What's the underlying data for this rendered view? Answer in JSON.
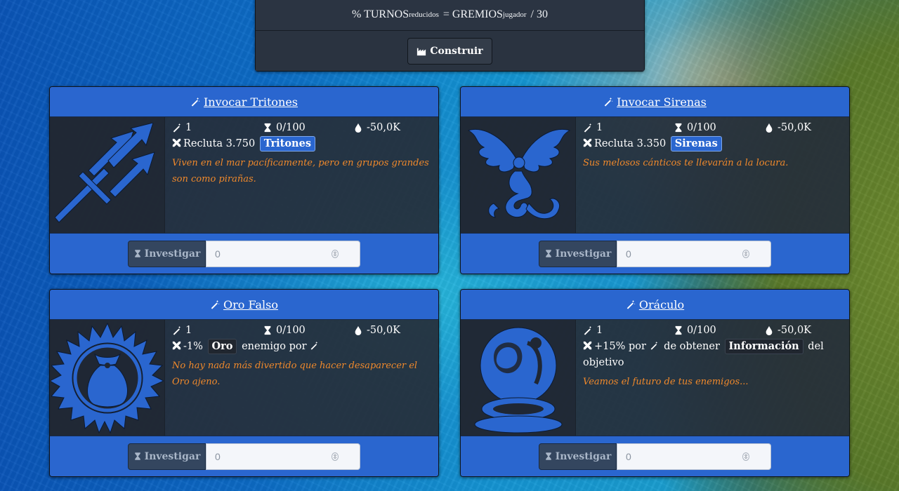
{
  "header": {
    "formula_prefix": "% TURNOS",
    "formula_sub1": "reducidos",
    "formula_mid": "= GREMIOS",
    "formula_sub2": "jugador",
    "formula_suffix": "/ 30",
    "build_label": "Construir"
  },
  "colors": {
    "accent": "#2a66cf",
    "panel": "#262e3a",
    "description": "#f0892b"
  },
  "cards": [
    {
      "title": "Invocar Tritones",
      "icon": "trident-icon",
      "level": "1",
      "progress": "0/100",
      "cost": "-50,0K",
      "line_pre": "Recluta 3.750",
      "badge": "Tritones",
      "description": "Viven en el mar pacíficamente, pero en grupos grandes son como pirañas.",
      "invest_label": "Investigar",
      "invest_value": "0"
    },
    {
      "title": "Invocar Sirenas",
      "icon": "siren-icon",
      "level": "1",
      "progress": "0/100",
      "cost": "-50,0K",
      "line_pre": "Recluta 3.350",
      "badge": "Sirenas",
      "description": "Sus melosos cánticos te llevarán a la locura.",
      "invest_label": "Investigar",
      "invest_value": "0"
    },
    {
      "title": "Oro Falso",
      "icon": "gold-sack-icon",
      "level": "1",
      "progress": "0/100",
      "cost": "-50,0K",
      "line_pre": "-1%",
      "badge": "Oro",
      "line_post": "enemigo por",
      "description": "No hay nada más divertido que hacer desaparecer el Oro ajeno.",
      "invest_label": "Investigar",
      "invest_value": "0"
    },
    {
      "title": "Oráculo",
      "icon": "crystal-ball-icon",
      "level": "1",
      "progress": "0/100",
      "cost": "-50,0K",
      "line_pre": "+15% por",
      "line_mid": "de obtener",
      "badge": "Información",
      "line_post": "del objetivo",
      "description": "Veamos el futuro de tus enemigos...",
      "invest_label": "Investigar",
      "invest_value": "0"
    }
  ]
}
